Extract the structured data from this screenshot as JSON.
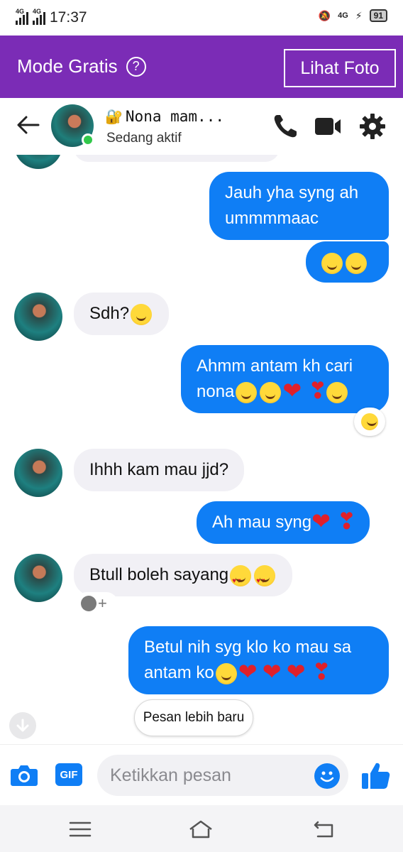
{
  "status_bar": {
    "time": "17:37",
    "net1": "4G",
    "net2": "4G",
    "net3": "4G",
    "battery": "91"
  },
  "banner": {
    "title": "Mode Gratis",
    "help_icon": "?",
    "button": "Lihat Foto",
    "color": "#7b2cb6"
  },
  "header": {
    "name": "Nona mam...",
    "status": "Sedang aktif"
  },
  "messages": {
    "m1": "Jauh yha syng ah ummmmaac",
    "m2": "Sdh?",
    "m3": "Ahmm antam kh cari nona",
    "m4": "Ihhh kam mau jjd?",
    "m5": "Ah mau syng",
    "m6": "Btull boleh sayang",
    "m7": "Betul nih syg klo ko mau sa antam ko",
    "add_reaction": "+"
  },
  "newer_button": "Pesan lebih baru",
  "composer": {
    "gif": "GIF",
    "placeholder": "Ketikkan pesan"
  },
  "colors": {
    "outgoing": "#0f7ef5",
    "incoming": "#f1f0f5",
    "accent": "#0f7ef5"
  }
}
